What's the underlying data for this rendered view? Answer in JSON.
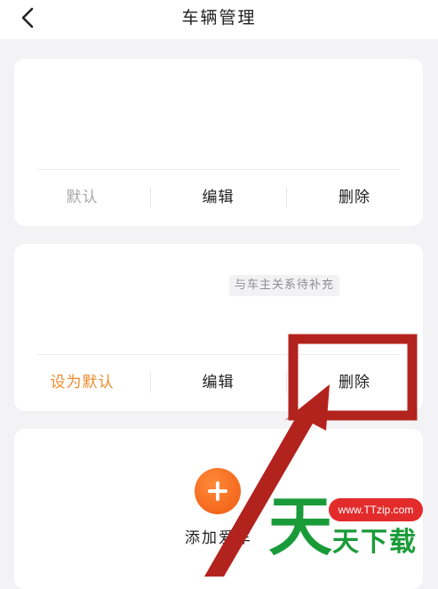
{
  "header": {
    "title": "车辆管理"
  },
  "vehicles": [
    {
      "default_label": "默认",
      "edit_label": "编辑",
      "delete_label": "删除"
    },
    {
      "remark": "与车主关系待补充",
      "default_label": "设为默认",
      "edit_label": "编辑",
      "delete_label": "删除"
    }
  ],
  "add_vehicle": {
    "label": "添加爱车"
  },
  "watermark": {
    "url": "www.TTzip.com",
    "big": "天",
    "small": "天下载"
  },
  "colors": {
    "accent": "#f08a2c",
    "muted": "#a8a8a8",
    "add_button": "#f05a10",
    "annotation": "#b3231e",
    "watermark_green": "#1a9b39",
    "watermark_red": "#e32b2b"
  },
  "icons": {
    "back": "chevron-left-icon",
    "add": "plus-icon"
  }
}
